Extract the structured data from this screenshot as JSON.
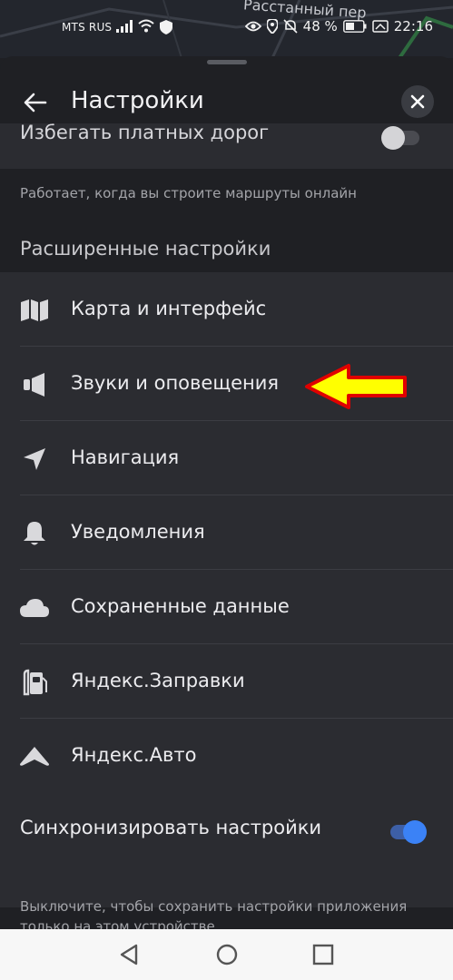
{
  "map": {
    "street_name": "Расстанный пер"
  },
  "status_bar": {
    "carrier": "MTS RUS",
    "battery_percent": "48 %",
    "time": "22:16"
  },
  "header": {
    "title": "Настройки"
  },
  "toll_roads": {
    "label": "Избегать платных дорог",
    "enabled": false,
    "hint": "Работает, когда вы строите маршруты онлайн"
  },
  "advanced": {
    "heading": "Расширенные настройки",
    "items": [
      {
        "label": "Карта и интерфейс",
        "icon": "map-icon"
      },
      {
        "label": "Звуки и оповещения",
        "icon": "speaker-icon"
      },
      {
        "label": "Навигация",
        "icon": "navigation-arrow-icon"
      },
      {
        "label": "Уведомления",
        "icon": "bell-icon"
      },
      {
        "label": "Сохраненные данные",
        "icon": "cloud-icon"
      },
      {
        "label": "Яндекс.Заправки",
        "icon": "fuel-pump-icon"
      },
      {
        "label": "Яндекс.Авто",
        "icon": "car-chevron-icon"
      }
    ]
  },
  "sync": {
    "label": "Синхронизировать настройки",
    "enabled": true,
    "hint": "Выключите, чтобы сохранить настройки приложения только на этом устройстве"
  },
  "colors": {
    "background": "#1f2024",
    "card": "#2b2c31",
    "accent_blue": "#3b82f6",
    "annotation_arrow_fill": "#ffff00",
    "annotation_arrow_stroke": "#e00000"
  }
}
